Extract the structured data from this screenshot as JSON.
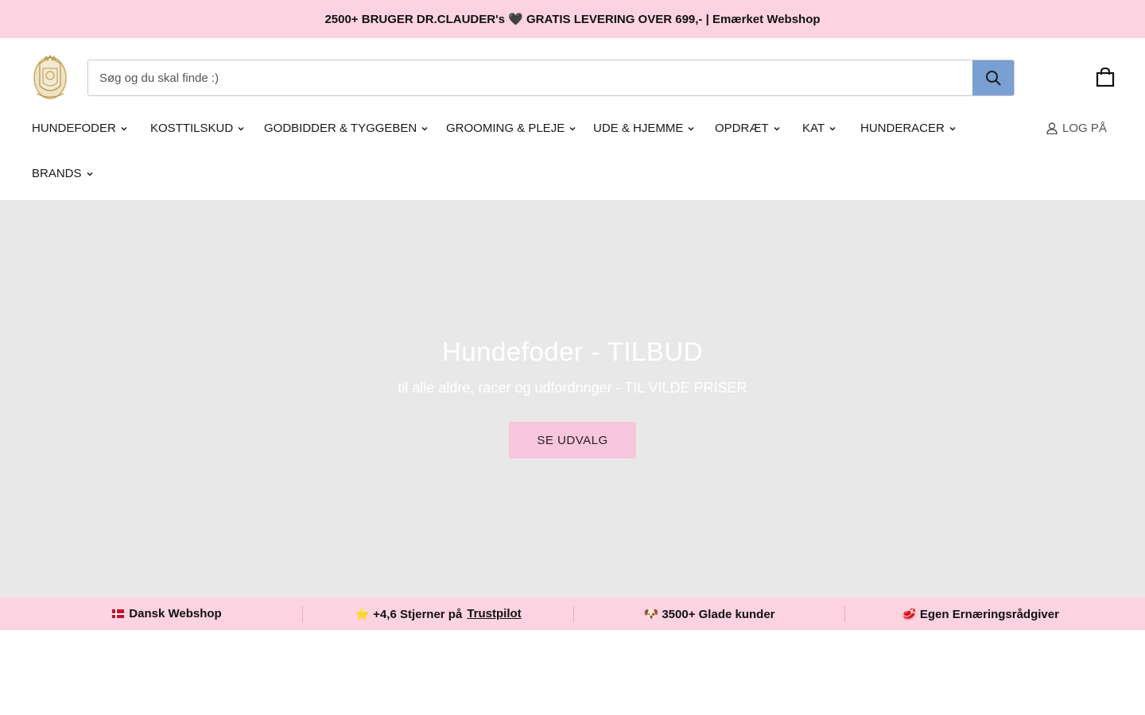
{
  "announcement": {
    "text": "2500+ BRUGER DR.CLAUDER's 🖤 GRATIS LEVERING OVER 699,- | Emærket Webshop"
  },
  "header": {
    "logo_icon": "crest-logo-icon",
    "search": {
      "placeholder": "Søg og du skal finde :)",
      "value": ""
    },
    "cart_icon": "shopping-bag-icon",
    "login_label": "LOG PÅ"
  },
  "nav": {
    "items": [
      {
        "label": "HUNDEFODER"
      },
      {
        "label": "KOSTTILSKUD"
      },
      {
        "label": "GODBIDDER & TYGGEBEN"
      },
      {
        "label": "GROOMING & PLEJE"
      },
      {
        "label": "UDE & HJEMME"
      },
      {
        "label": "OPDRÆT"
      },
      {
        "label": "KAT"
      },
      {
        "label": "HUNDERACER"
      },
      {
        "label": "BRANDS"
      }
    ]
  },
  "hero": {
    "title": "Hundefoder - TILBUD",
    "subtitle": "til alle aldre, racer og udfordringer - TIL VILDE PRISER",
    "button_label": "SE UDVALG"
  },
  "usp": {
    "item1": "Dansk Webshop",
    "item2_prefix": "⭐ +4,6 Stjerner på",
    "item2_link": "Trustpilot",
    "item3": "🐶 3500+ Glade kunder",
    "item4": "🥩 Egen Ernæringsrådgiver"
  },
  "colors": {
    "announcement_bg": "#fdd3e2",
    "search_button": "#7a9fd3",
    "hero_bg": "#e8e8e8",
    "hero_button": "#f8c6dc"
  }
}
